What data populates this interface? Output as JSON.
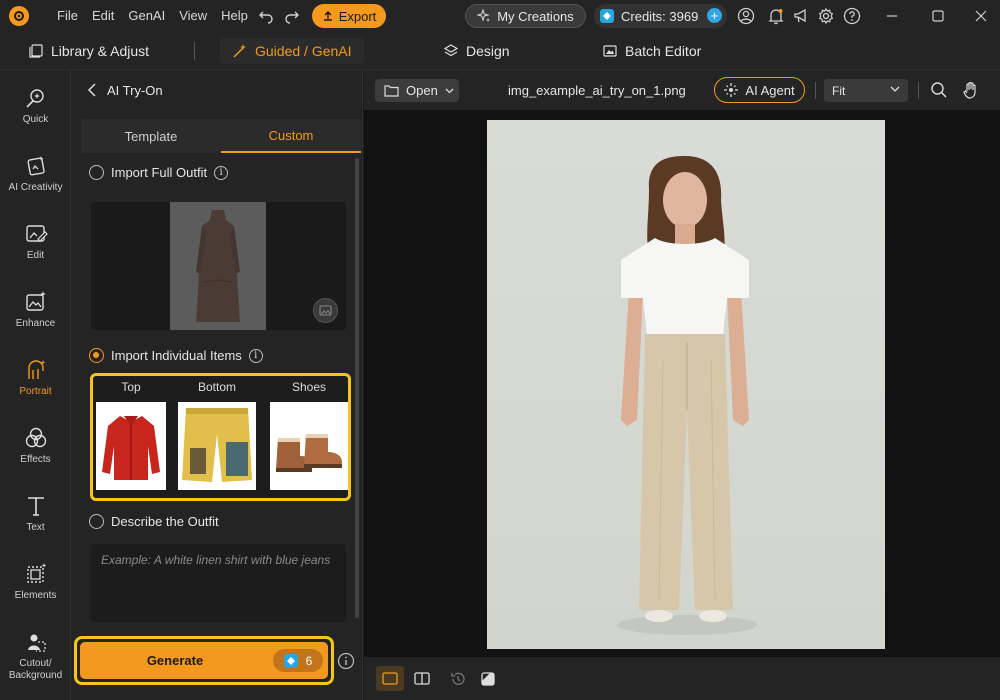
{
  "menu": [
    "File",
    "Edit",
    "GenAI",
    "View",
    "Help"
  ],
  "toolbar": {
    "export_label": "Export",
    "my_creations_label": "My Creations",
    "credits_label": "Credits: 3969"
  },
  "modes": {
    "library": "Library & Adjust",
    "guided": "Guided / GenAI",
    "design": "Design",
    "batch": "Batch Editor"
  },
  "rail": [
    "Quick",
    "AI Creativity",
    "Edit",
    "Enhance",
    "Portrait",
    "Effects",
    "Text",
    "Elements",
    "Cutout/\nBackground"
  ],
  "panel": {
    "title": "AI Try-On",
    "tabs": [
      "Template",
      "Custom"
    ],
    "full_outfit_label": "Import Full Outfit",
    "individual_label": "Import Individual Items",
    "items": [
      "Top",
      "Bottom",
      "Shoes"
    ],
    "describe_label": "Describe the Outfit",
    "describe_placeholder": "Example: A white linen shirt with blue jeans",
    "generate_label": "Generate",
    "generate_cost": "6"
  },
  "canvas": {
    "open_label": "Open",
    "filename": "img_example_ai_try_on_1.png",
    "ai_agent_label": "AI Agent",
    "zoom_option": "Fit"
  },
  "colors": {
    "accent": "#f39a1e",
    "highlight": "#f5c518",
    "background": "#242424"
  }
}
